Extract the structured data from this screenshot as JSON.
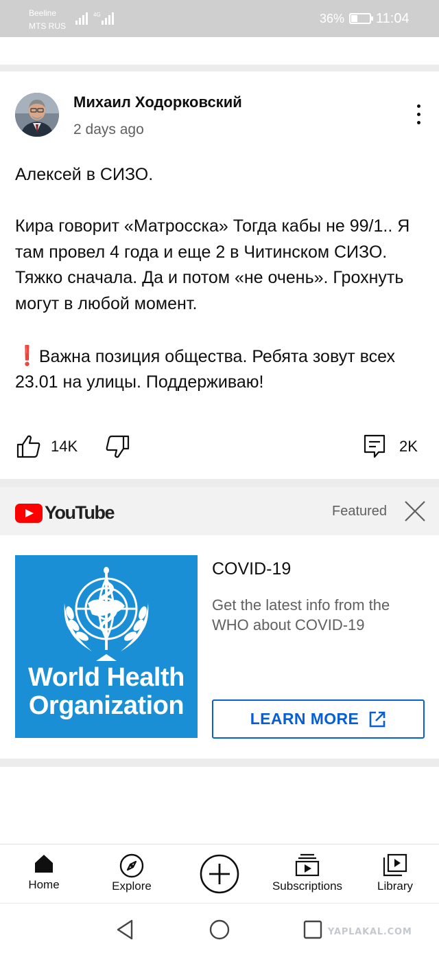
{
  "status_bar": {
    "carrier_1": "Beeline",
    "carrier_2": "MTS RUS",
    "network": "4G",
    "battery_percent": "36%",
    "battery_level": 0.36,
    "time": "11:04",
    "text_color": "#ffffff"
  },
  "post": {
    "author": "Михаил Ходорковский",
    "time_ago": "2 days ago",
    "paragraph_1": "Алексей в СИЗО.",
    "paragraph_2": "Кира говорит «Матросска» Тогда кабы не 99/1.. Я там провел 4 года и еще 2 в Читинском СИЗО. Тяжко сначала. Да и потом «не очень». Грохнуть могут в любой момент.",
    "paragraph_3_mark": "❗",
    "paragraph_3": "Важна позиция общества. Ребята зовут всех 23.01 на улицы. Поддерживаю!",
    "likes": "14K",
    "comments": "2K",
    "icons": [
      "like-icon",
      "dislike-icon",
      "comment-icon",
      "more-vert-icon"
    ]
  },
  "featured": {
    "brand": "YouTube",
    "label": "Featured",
    "brand_color": "#ff0000",
    "card": {
      "logo_text_line_1": "World Health",
      "logo_text_line_2": "Organization",
      "logo_color": "#1a8fd6",
      "title": "COVID-19",
      "description": "Get the latest info from the WHO about COVID-19",
      "button_label": "LEARN MORE",
      "button_color": "#065fd4"
    }
  },
  "bottom_nav": {
    "items": [
      {
        "label": "Home",
        "icon": "home-icon"
      },
      {
        "label": "Explore",
        "icon": "compass-icon"
      },
      {
        "label": "",
        "icon": "create-plus-icon"
      },
      {
        "label": "Subscriptions",
        "icon": "subscriptions-icon"
      },
      {
        "label": "Library",
        "icon": "library-icon"
      }
    ]
  },
  "system_nav": {
    "icons": [
      "back-icon",
      "home-circle-icon",
      "recents-icon"
    ]
  },
  "watermark": "YAPLAKAL.COM"
}
